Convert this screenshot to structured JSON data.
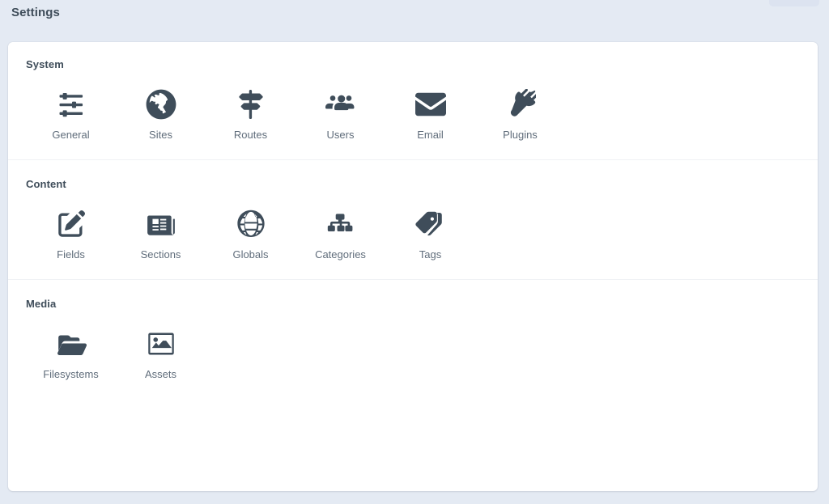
{
  "header": {
    "title": "Settings",
    "ghost_button_label": ""
  },
  "theme": {
    "page_background": "#e4eaf3",
    "card_background": "#ffffff",
    "icon_color": "#3f4d5a",
    "label_color": "#606d7b",
    "heading_color": "#3f4d5a",
    "divider_color": "#f0f2f5"
  },
  "groups": [
    {
      "title": "System",
      "items": [
        {
          "label": "General",
          "icon": "sliders-icon"
        },
        {
          "label": "Sites",
          "icon": "globe-americas-icon"
        },
        {
          "label": "Routes",
          "icon": "signpost-icon"
        },
        {
          "label": "Users",
          "icon": "users-group-icon"
        },
        {
          "label": "Email",
          "icon": "envelope-icon"
        },
        {
          "label": "Plugins",
          "icon": "plug-icon"
        }
      ]
    },
    {
      "title": "Content",
      "items": [
        {
          "label": "Fields",
          "icon": "pencil-square-icon"
        },
        {
          "label": "Sections",
          "icon": "newspaper-icon"
        },
        {
          "label": "Globals",
          "icon": "globe-wireframe-icon"
        },
        {
          "label": "Categories",
          "icon": "sitemap-icon"
        },
        {
          "label": "Tags",
          "icon": "tags-icon"
        }
      ]
    },
    {
      "title": "Media",
      "items": [
        {
          "label": "Filesystems",
          "icon": "folder-open-icon"
        },
        {
          "label": "Assets",
          "icon": "image-icon"
        }
      ]
    }
  ]
}
